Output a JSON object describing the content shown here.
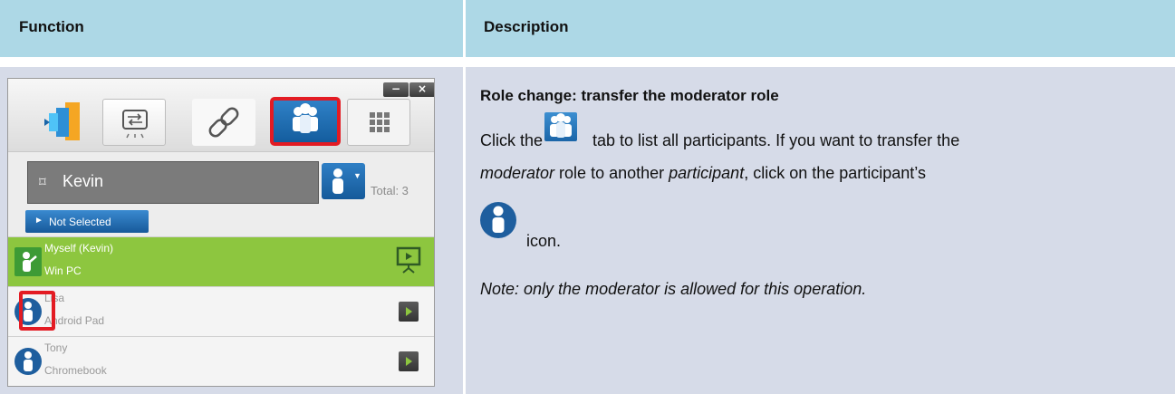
{
  "table": {
    "header_function": "Function",
    "header_description": "Description"
  },
  "app": {
    "window_buttons": {
      "minimize": "−",
      "close": "×"
    },
    "tabs": [
      "screen-share-icon",
      "link-icon",
      "participants-icon",
      "grid-icon"
    ],
    "active_tab": "participants-icon",
    "current_user": "Kevin",
    "total_label": "Total: 3",
    "not_selected_label": "Not Selected",
    "participants": [
      {
        "name": "Myself (Kevin)",
        "device": "Win PC",
        "role": "moderator",
        "status": "presenting"
      },
      {
        "name": "Lisa",
        "device": "Android Pad",
        "role": "participant",
        "status": "play"
      },
      {
        "name": "Tony",
        "device": "Chromebook",
        "role": "participant",
        "status": "play"
      }
    ],
    "colors": {
      "highlight_row": "#8dc63f",
      "accent_blue": "#1e6db4",
      "callout_red": "#e31b23"
    }
  },
  "description": {
    "title": "Role change: transfer the moderator role",
    "line1_before": "Click the",
    "line1_after": "tab to list all participants. If you want to transfer the",
    "line2_em1": "moderator",
    "line2_mid": " role to another ",
    "line2_em2": "participant",
    "line2_end": ", click on the participant’s",
    "icon_word": "icon.",
    "note": "Note: only the moderator is allowed for this operation."
  }
}
